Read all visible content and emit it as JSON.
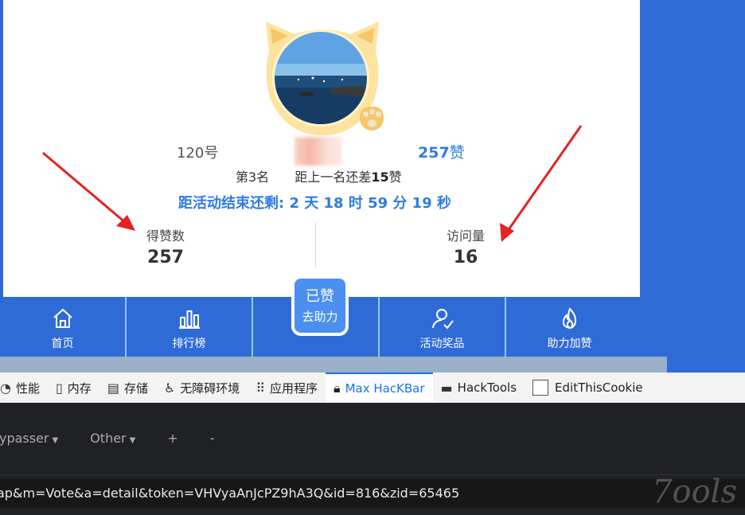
{
  "profile": {
    "number": "120号",
    "likes_value": "257",
    "likes_unit": "赞",
    "rank": "第3名",
    "gap_prefix": "距上一名还差",
    "gap_value": "15",
    "gap_unit": "赞",
    "countdown": "距活动结束还剩: 2 天 18 时 59 分 19 秒"
  },
  "stats": {
    "likes_label": "得赞数",
    "likes_value": "257",
    "visits_label": "访问量",
    "visits_value": "16"
  },
  "bottom_nav": {
    "home": "首页",
    "ranking": "排行榜",
    "center_top": "已赞",
    "center_bottom": "去助力",
    "prizes": "活动奖品",
    "boost": "助力加赞"
  },
  "devtools": {
    "tabs": [
      {
        "label": "性能",
        "icon": "performance-icon"
      },
      {
        "label": "内存",
        "icon": "memory-icon"
      },
      {
        "label": "存储",
        "icon": "storage-icon"
      },
      {
        "label": "无障碍环境",
        "icon": "accessibility-icon"
      },
      {
        "label": "应用程序",
        "icon": "apps-grid-icon"
      },
      {
        "label": "Max HacKBar",
        "icon": "lock-icon"
      },
      {
        "label": "HackTools",
        "icon": "hat-icon"
      },
      {
        "label": "EditThisCookie",
        "icon": "checkbox-icon"
      }
    ],
    "active_tab": "Max HacKBar"
  },
  "hackbar": {
    "menu_bypasser": "Bypasser",
    "menu_other": "Other",
    "plus": "+",
    "minus": "-",
    "url": "ap&m=Vote&a=detail&token=VHVyaAnJcPZ9hA3Q&id=816&zid=65465"
  },
  "watermark": "7ools",
  "colors": {
    "accent_blue": "#2e7de0",
    "nav_blue": "#2f6bd7",
    "arrow_red": "#e32222",
    "hackbar_bg": "#202124"
  }
}
